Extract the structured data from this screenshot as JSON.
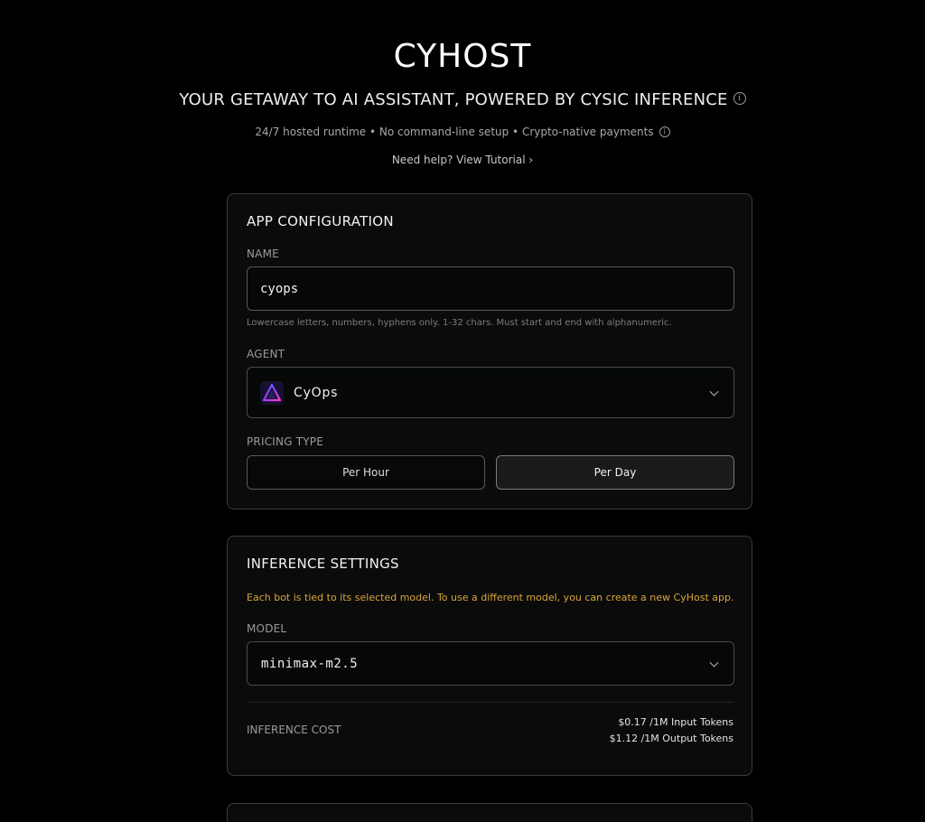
{
  "header": {
    "brand": "CYHOST",
    "tagline": "YOUR GETAWAY TO AI ASSISTANT, POWERED BY CYSIC INFERENCE",
    "features": "24/7 hosted runtime • No command-line setup • Crypto-native payments",
    "help_prefix": "Need help?",
    "help_link": "View Tutorial ›"
  },
  "app_config": {
    "title": "APP CONFIGURATION",
    "name_label": "NAME",
    "name_value": "cyops",
    "name_hint": "Lowercase letters, numbers, hyphens only. 1-32 chars. Must start and end with alphanumeric.",
    "agent_label": "AGENT",
    "agent_value": "CyOps",
    "pricing_label": "PRICING TYPE",
    "pricing_options": [
      "Per Hour",
      "Per Day"
    ],
    "pricing_selected": "Per Day"
  },
  "inference": {
    "title": "INFERENCE SETTINGS",
    "notice": "Each bot is tied to its selected model. To use a different model, you can create a new CyHost app.",
    "model_label": "MODEL",
    "model_value": "minimax-m2.5",
    "cost_label": "INFERENCE COST",
    "cost_input": "$0.17 /1M Input Tokens",
    "cost_output": "$1.12 /1M Output Tokens"
  },
  "colors": {
    "background": "#000000",
    "card_border": "#3a3a3a",
    "notice": "#d9a63a"
  },
  "icons": {
    "tagline_info": "info-icon",
    "features_info": "info-icon",
    "agent_logo": "cyops-triangle-logo",
    "select_chevron": "chevron-down-icon"
  }
}
